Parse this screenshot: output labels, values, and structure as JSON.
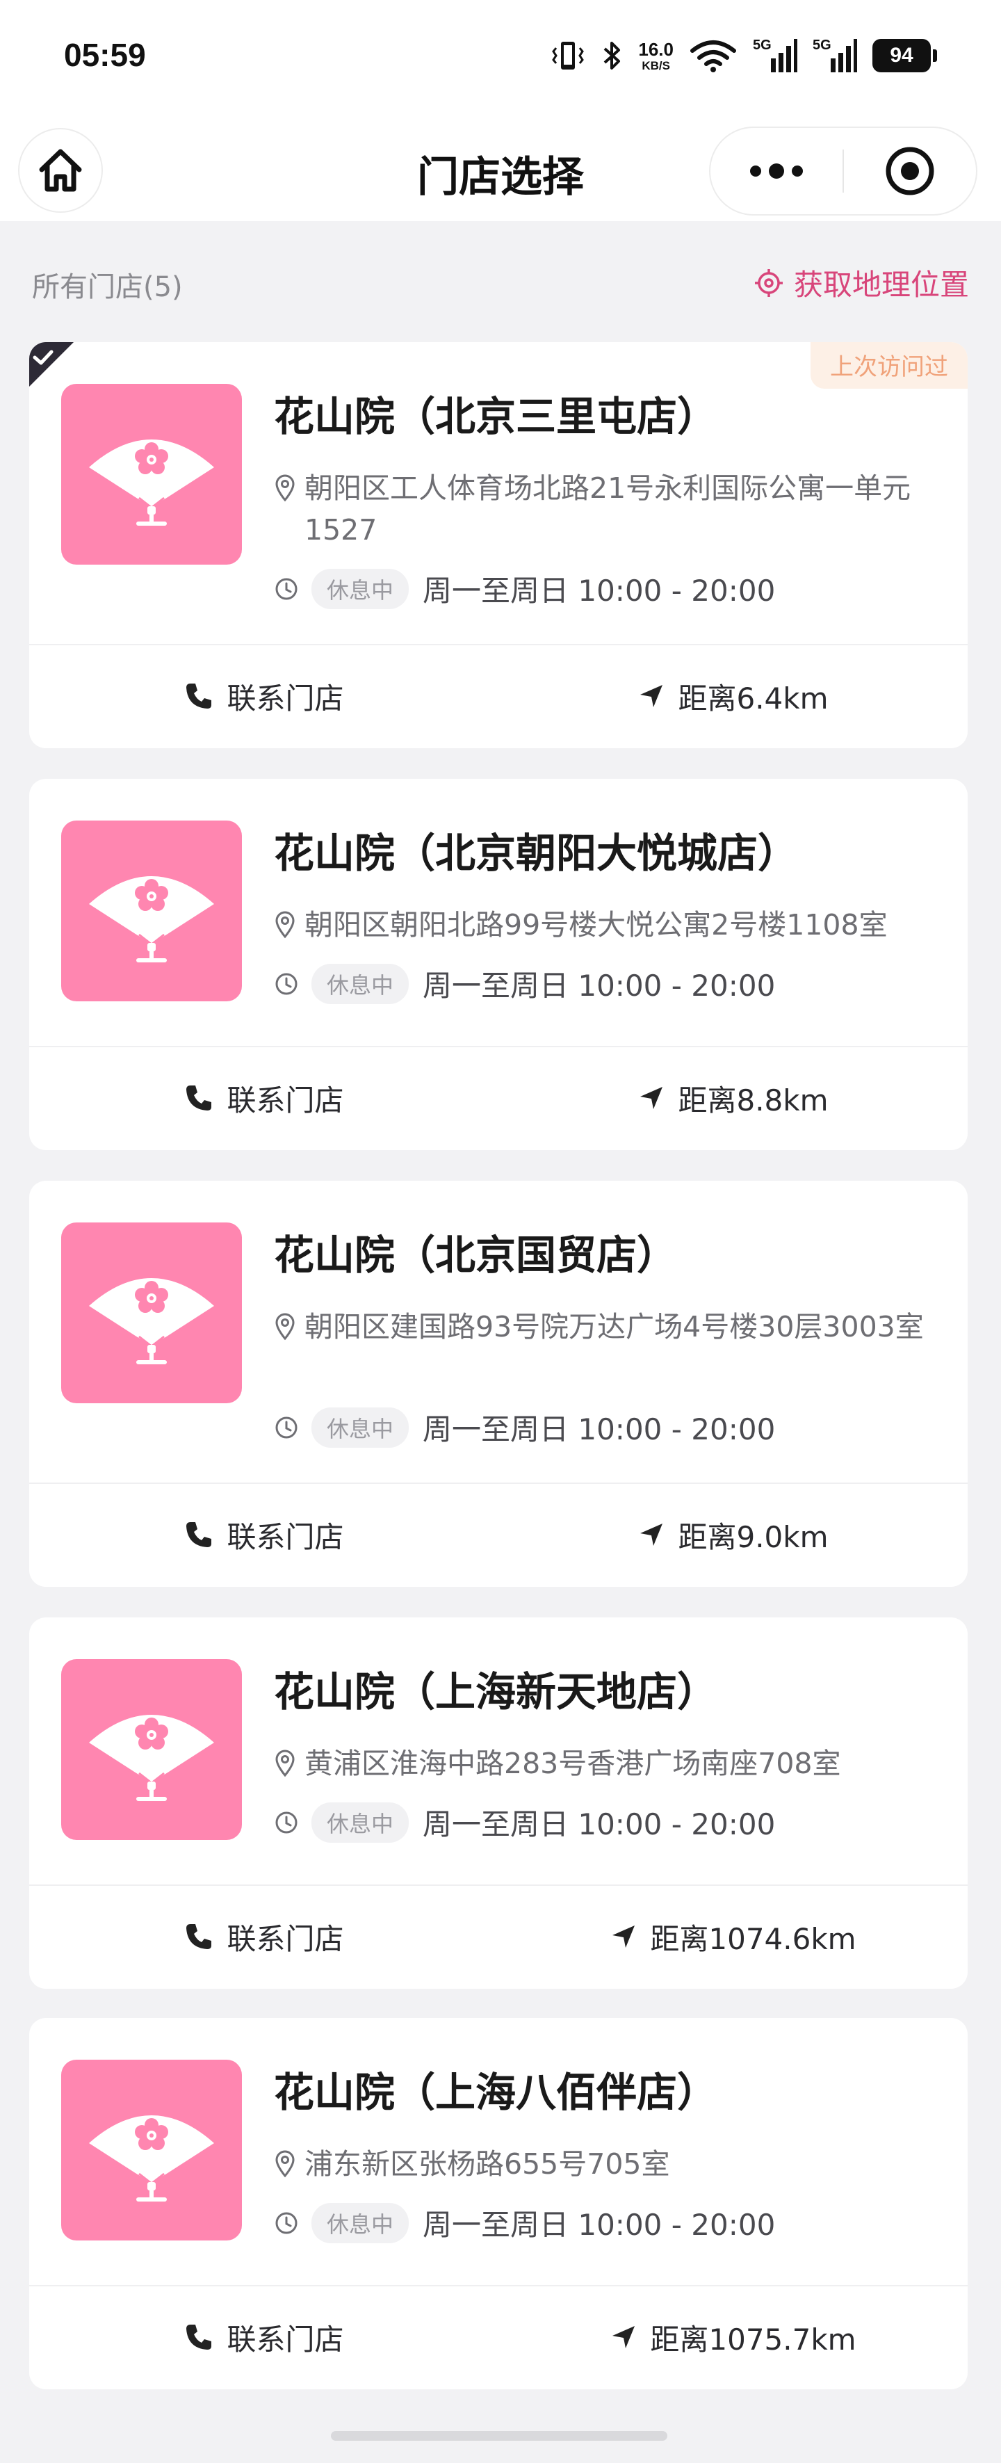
{
  "status_bar": {
    "time": "05:59",
    "net_speed_value": "16.0",
    "net_speed_unit": "KB/S",
    "signal_1_label": "5G",
    "signal_2_label": "5G",
    "battery": "94"
  },
  "nav": {
    "title": "门店选择",
    "home_icon": "home-icon",
    "more_icon": "more-dots-icon",
    "close_icon": "target-close-icon"
  },
  "list": {
    "all_stores_label": "所有门店(5)",
    "get_location_label": "获取地理位置",
    "accent_color": "#d8457a",
    "logo_bg_color": "#ff86b0"
  },
  "stores": [
    {
      "name": "花山院（北京三里屯店）",
      "address": "朝阳区工人体育场北路21号永利国际公寓一单元1527",
      "status": "休息中",
      "hours": "周一至周日 10:00 - 20:00",
      "contact_label": "联系门店",
      "distance": "距离6.4km",
      "badge": "上次访问过",
      "selected": true
    },
    {
      "name": "花山院（北京朝阳大悦城店）",
      "address": "朝阳区朝阳北路99号楼大悦公寓2号楼1108室",
      "status": "休息中",
      "hours": "周一至周日 10:00 - 20:00",
      "contact_label": "联系门店",
      "distance": "距离8.8km"
    },
    {
      "name": "花山院（北京国贸店）",
      "address": "朝阳区建国路93号院万达广场4号楼30层3003室",
      "status": "休息中",
      "hours": "周一至周日 10:00 - 20:00",
      "contact_label": "联系门店",
      "distance": "距离9.0km"
    },
    {
      "name": "花山院（上海新天地店）",
      "address": "黄浦区淮海中路283号香港广场南座708室",
      "status": "休息中",
      "hours": "周一至周日 10:00 - 20:00",
      "contact_label": "联系门店",
      "distance": "距离1074.6km"
    },
    {
      "name": "花山院（上海八佰伴店）",
      "address": "浦东新区张杨路655号705室",
      "status": "休息中",
      "hours": "周一至周日 10:00 - 20:00",
      "contact_label": "联系门店",
      "distance": "距离1075.7km"
    }
  ]
}
